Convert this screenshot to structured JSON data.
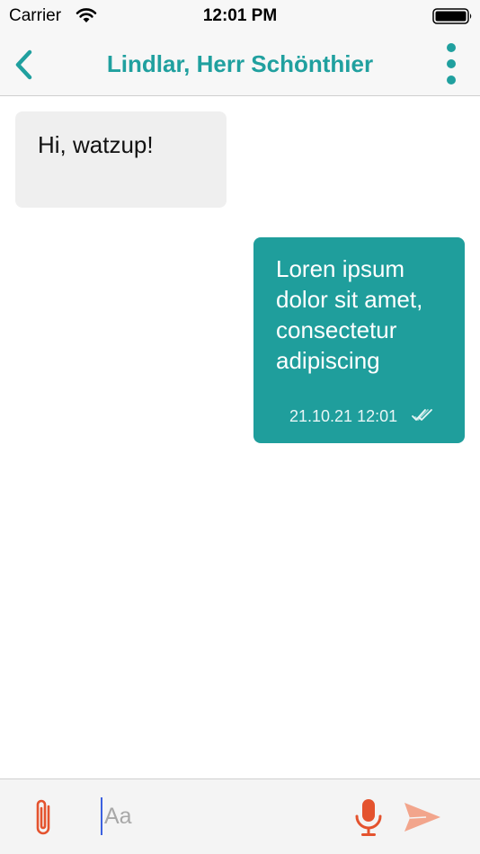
{
  "status_bar": {
    "carrier": "Carrier",
    "time": "12:01 PM",
    "icons": [
      "wifi-icon",
      "battery-icon"
    ]
  },
  "header": {
    "title": "Lindlar, Herr Schönthier",
    "back_icon": "chevron-left-icon",
    "menu_icon": "more-vertical-icon"
  },
  "messages": [
    {
      "direction": "incoming",
      "text": "Hi, watzup!"
    },
    {
      "direction": "outgoing",
      "text": "Loren ipsum dolor sit amet, consectetur adipiscing",
      "timestamp": "21.10.21 12:01",
      "status_icon": "double-check-icon"
    }
  ],
  "composer": {
    "placeholder": "Aa",
    "value": "",
    "attach_icon": "paperclip-icon",
    "mic_icon": "microphone-icon",
    "send_icon": "send-icon"
  },
  "colors": {
    "accent": "#20a09f",
    "outgoing_bubble": "#1f9e9c",
    "incoming_bubble": "#efefef",
    "action_icons": "#e4532e",
    "send_icon": "#f2a58c"
  }
}
